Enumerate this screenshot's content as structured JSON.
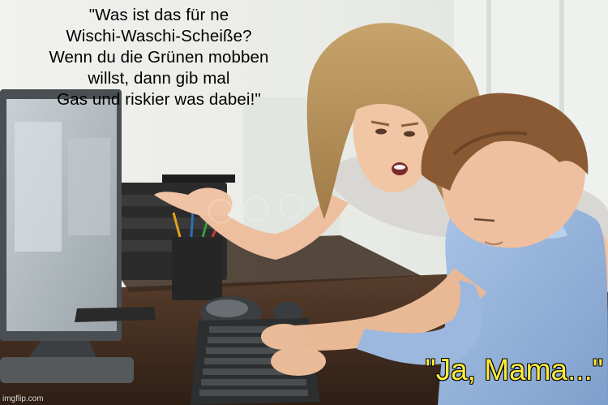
{
  "caption_top": {
    "lines": [
      "\"Was ist das für ne",
      "Wischi-Waschi-Scheiße?",
      "Wenn du die Grünen mobben",
      "willst, dann gib mal",
      "Gas und riskier was dabei!\""
    ]
  },
  "caption_bottom": "\"Ja, Mama...\"",
  "watermark": "imgflip.com",
  "colors": {
    "caption_bottom": "#ffeb3b",
    "caption_top": "#000000"
  }
}
